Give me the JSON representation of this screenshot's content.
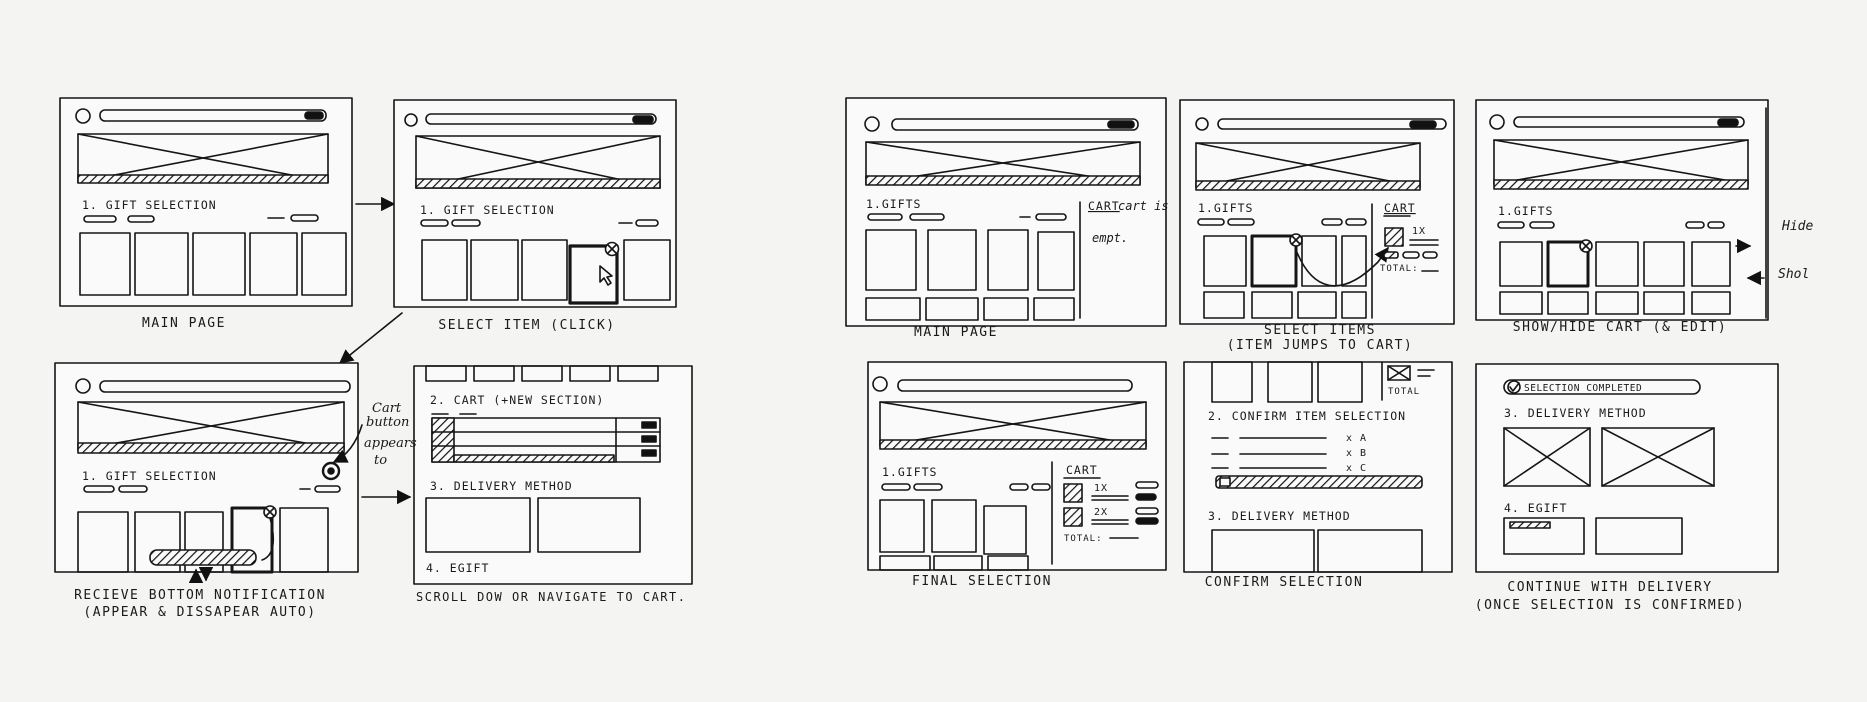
{
  "left_board": {
    "frame1": {
      "section": "1. GIFT SELECTION",
      "caption": "MAIN PAGE"
    },
    "frame2": {
      "section": "1. GIFT SELECTION",
      "caption": "SELECT ITEM (CLICK)"
    },
    "frame3": {
      "section": "1. GIFT SELECTION",
      "caption_line1": "RECIEVE BOTTOM NOTIFICATION",
      "caption_line2": "(APPEAR & DISSAPEAR AUTO)",
      "note_line1": "Cart",
      "note_line2": "button",
      "note_line3": "appears",
      "note_line4": "to"
    },
    "frame4": {
      "cart_section": "2. CART (+NEW SECTION)",
      "delivery_section": "3. DELIVERY METHOD",
      "egift_section": "4. EGIFT",
      "caption": "SCROLL DOW OR NAVIGATE TO CART."
    }
  },
  "right_board": {
    "frame1": {
      "section": "1.GIFTS",
      "cart_title": "CART",
      "cart_empty_line1": "cart is",
      "cart_empty_line2": "empt.",
      "caption": "MAIN PAGE"
    },
    "frame2": {
      "section": "1.GIFTS",
      "cart_title": "CART",
      "qty": "1X",
      "total_label": "TOTAL:",
      "caption_line1": "SELECT ITEMS",
      "caption_line2": "(ITEM JUMPS TO CART)"
    },
    "frame3": {
      "section": "1.GIFTS",
      "hide_label": "Hide",
      "show_label": "Shol",
      "caption": "SHOW/HIDE CART (& EDIT)"
    },
    "frame4": {
      "section": "1.GIFTS",
      "cart_title": "CART",
      "qty1": "1X",
      "qty2": "2X",
      "total_label": "TOTAL:",
      "caption": "FINAL SELECTION"
    },
    "frame5": {
      "total_label": "TOTAL",
      "confirm_section": "2. CONFIRM ITEM SELECTION",
      "item_a": "x A",
      "item_b": "x B",
      "item_c": "x C",
      "delivery_section": "3. DELIVERY METHOD",
      "caption": "CONFIRM SELECTION"
    },
    "frame6": {
      "completed_label": "SELECTION COMPLETED",
      "delivery_section": "3. DELIVERY METHOD",
      "egift_section": "4. EGIFT",
      "caption_line1": "CONTINUE WITH DELIVERY",
      "caption_line2": "(ONCE SELECTION IS CONFIRMED)"
    }
  }
}
